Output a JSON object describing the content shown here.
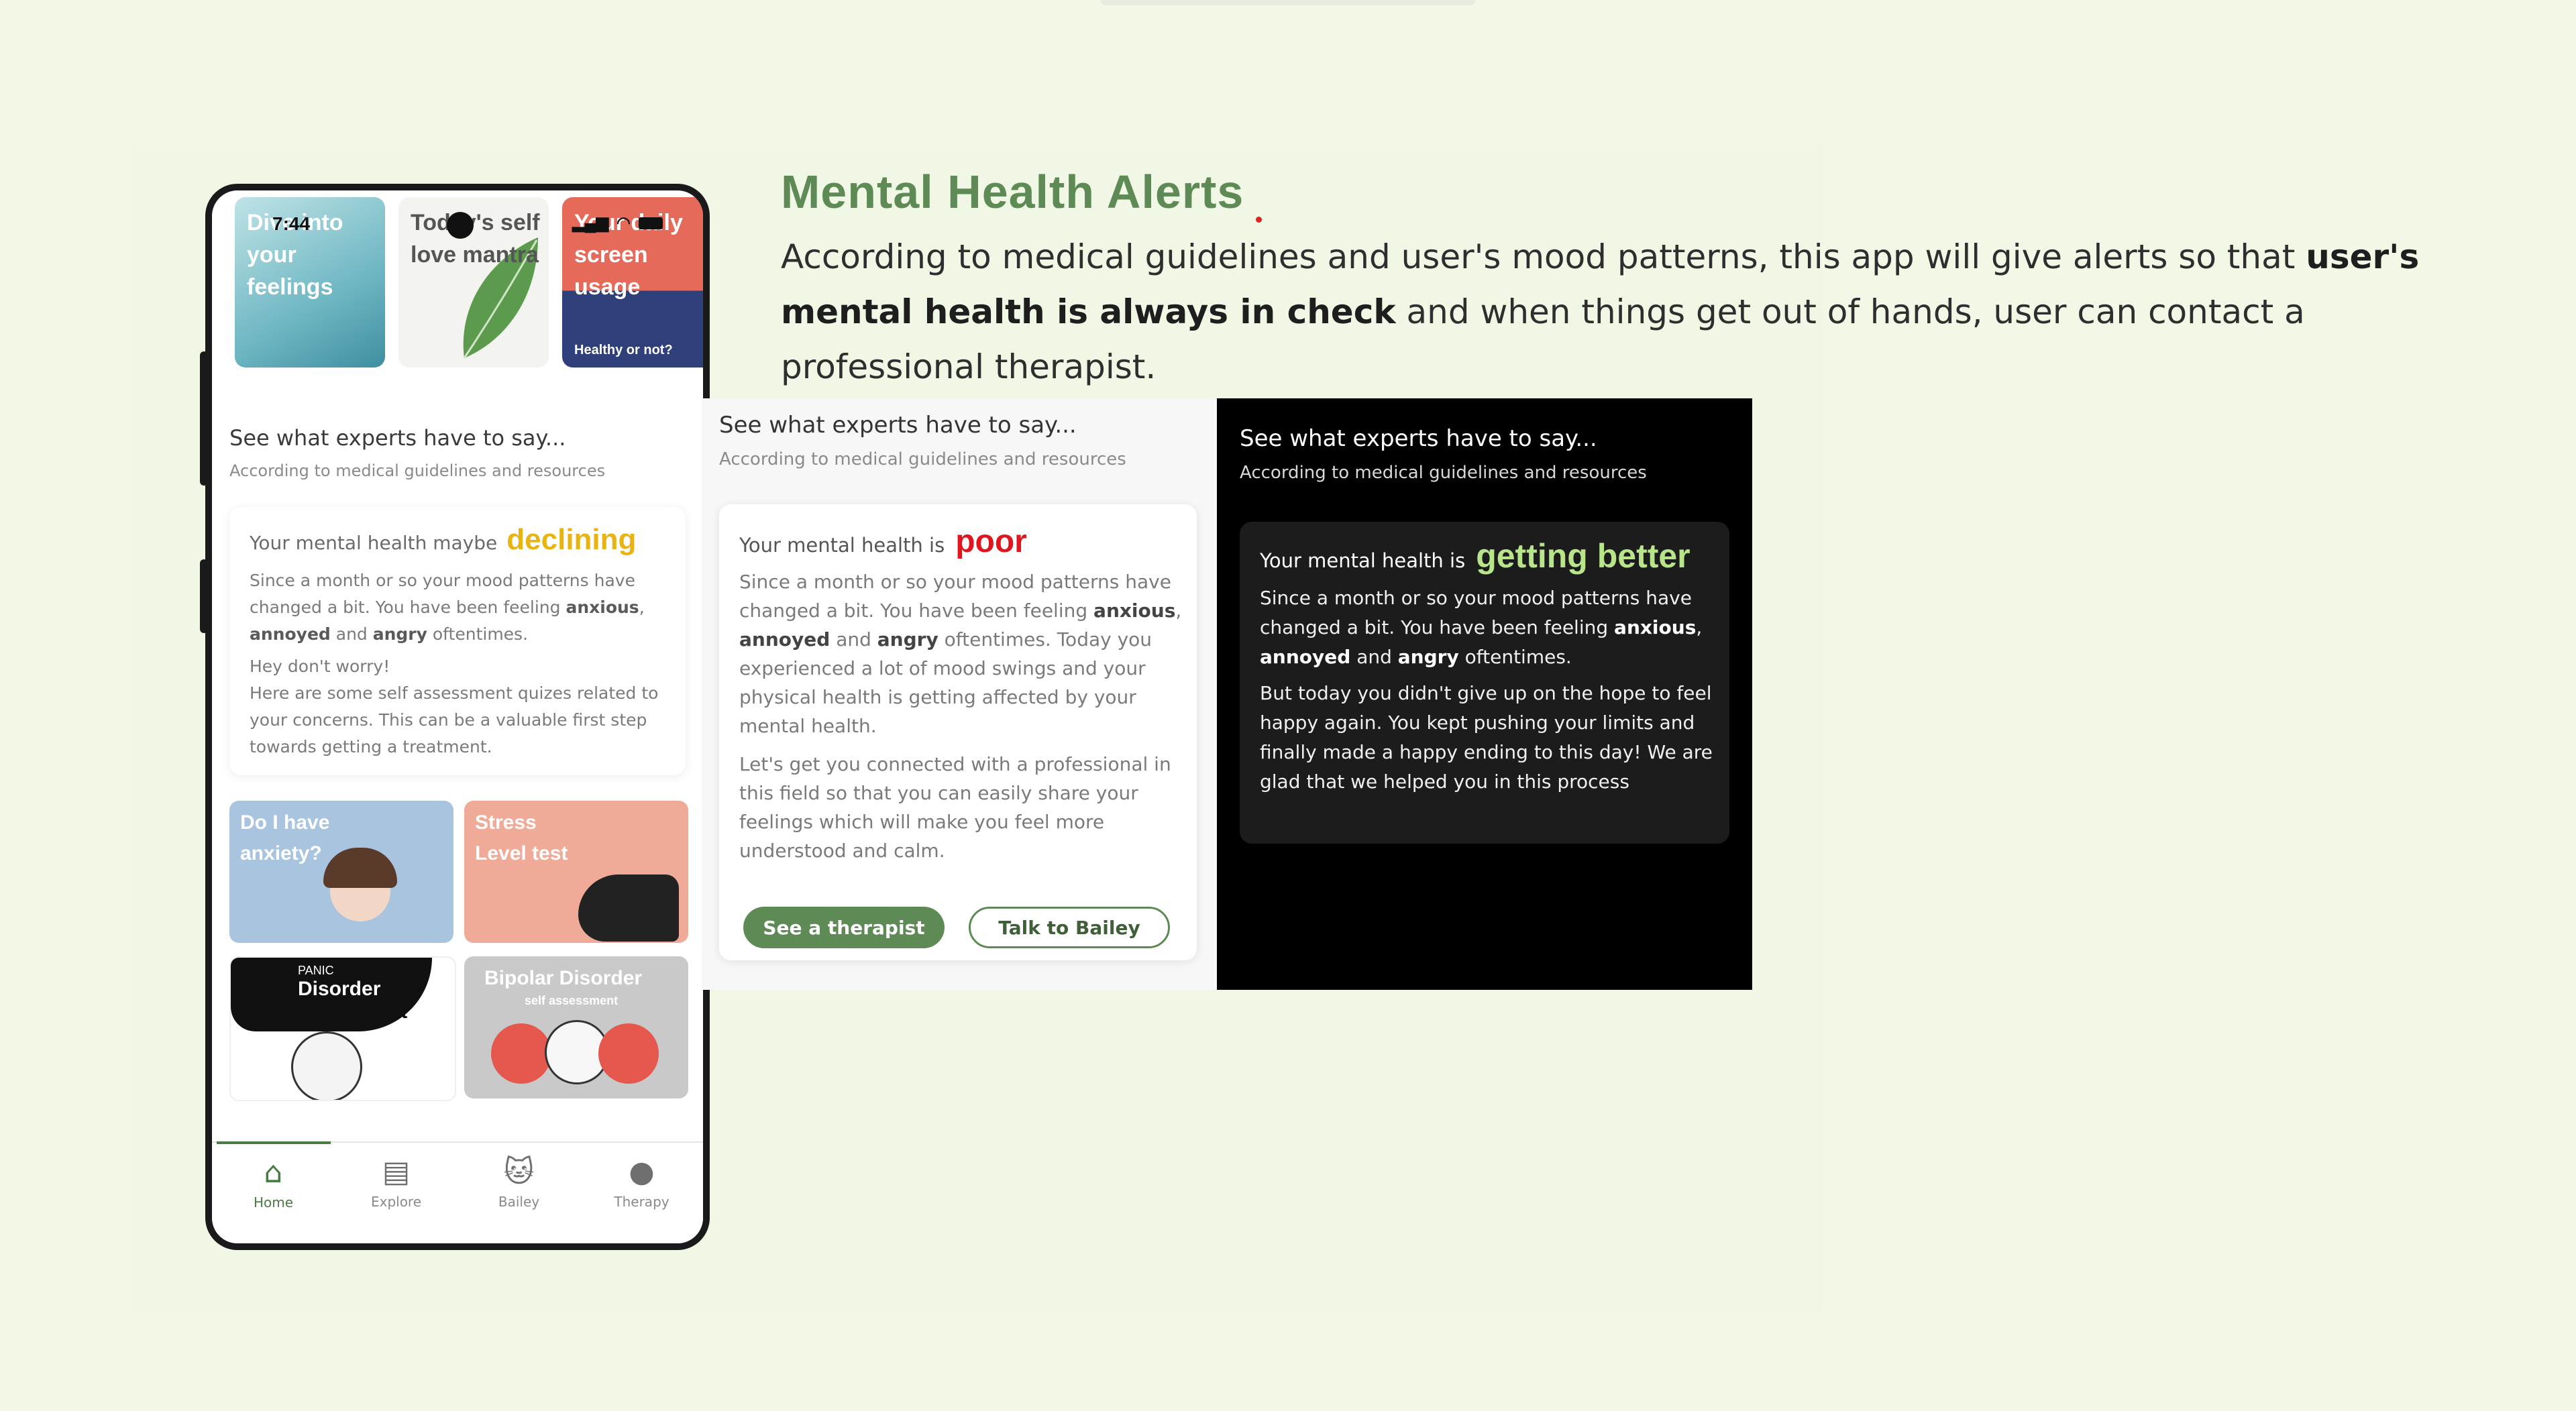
{
  "header": {
    "title": "Mental Health Alerts",
    "desc_1": "According to medical guidelines and user's mood patterns, this app will give alerts so that ",
    "desc_bold": "user's mental health is always in check",
    "desc_2": " and when things get out of hands, user can contact a professional therapist."
  },
  "colors": {
    "background": "#f1f8e6",
    "accent_green": "#5e8a56",
    "declining": "#e8b413",
    "poor": "#e0161e",
    "getting_better": "#b9e58a"
  },
  "phone": {
    "status": {
      "time": "7:44"
    },
    "top_cards": [
      {
        "title": "Dive into your feelings"
      },
      {
        "title": "Today's self love mantra"
      },
      {
        "title": "Your daily screen usage",
        "sub": "Healthy or not?"
      }
    ],
    "experts_heading": "See what experts have to say...",
    "experts_sub": "According to medical guidelines and resources",
    "alert": {
      "prefix": "Your mental health maybe",
      "keyword": "declining",
      "body_1": "Since a month or so your mood patterns have changed a bit. You have been feeling ",
      "w_anxious": "anxious",
      "sep": ", ",
      "w_annoyed": "annoyed",
      "and": " and ",
      "w_angry": "angry",
      "tail": " oftentimes.",
      "body_2": "Hey don't worry!",
      "body_3": "Here are some self assessment quizes related to your concerns. This can be a valuable first step towards getting a treatment."
    },
    "quiz_cards": [
      {
        "title": "Do I have anxiety?"
      },
      {
        "title": "Stress Level test"
      },
      {
        "title_small": "PANIC",
        "title": "Disorder",
        "title_2": "test"
      },
      {
        "title": "Bipolar Disorder",
        "sub": "self assessment"
      }
    ],
    "tabs": [
      {
        "label": "Home",
        "icon": "home-icon",
        "glyph": "⌂"
      },
      {
        "label": "Explore",
        "icon": "explore-icon",
        "glyph": "▤"
      },
      {
        "label": "Bailey",
        "icon": "cat-icon",
        "glyph": "🐱"
      },
      {
        "label": "Therapy",
        "icon": "person-icon",
        "glyph": "●"
      }
    ]
  },
  "light_panel": {
    "heading": "See what experts have to say...",
    "sub": "According to medical guidelines and resources",
    "prefix": "Your mental health is",
    "keyword": "poor",
    "body_1": "Since a month or so your mood patterns have changed a bit. You have been feeling ",
    "w_anxious": "anxious",
    "sep": ", ",
    "w_annoyed": "annoyed",
    "and": " and ",
    "w_angry": "angry",
    "tail": " oftentimes. Today you experienced a lot of mood swings and your physical health is getting affected by your mental health.",
    "body_2": "Let's get you connected with a professional in this field so that you can easily share your feelings which will make you feel more understood and calm.",
    "btn_therapist": "See a therapist",
    "btn_bailey": "Talk to Bailey"
  },
  "dark_panel": {
    "heading": "See what experts have to say...",
    "sub": "According to medical guidelines and resources",
    "prefix": "Your mental health is",
    "keyword": "getting better",
    "body_1": "Since a month or so your mood patterns have changed a bit. You have been feeling ",
    "w_anxious": "anxious",
    "sep": ", ",
    "w_annoyed": "annoyed",
    "and": " and ",
    "w_angry": "angry",
    "tail": " oftentimes.",
    "body_2": "But today you didn't give up on the hope to feel happy again. You kept pushing your limits and finally made a happy ending to this day! We are glad that we helped you in this process"
  }
}
